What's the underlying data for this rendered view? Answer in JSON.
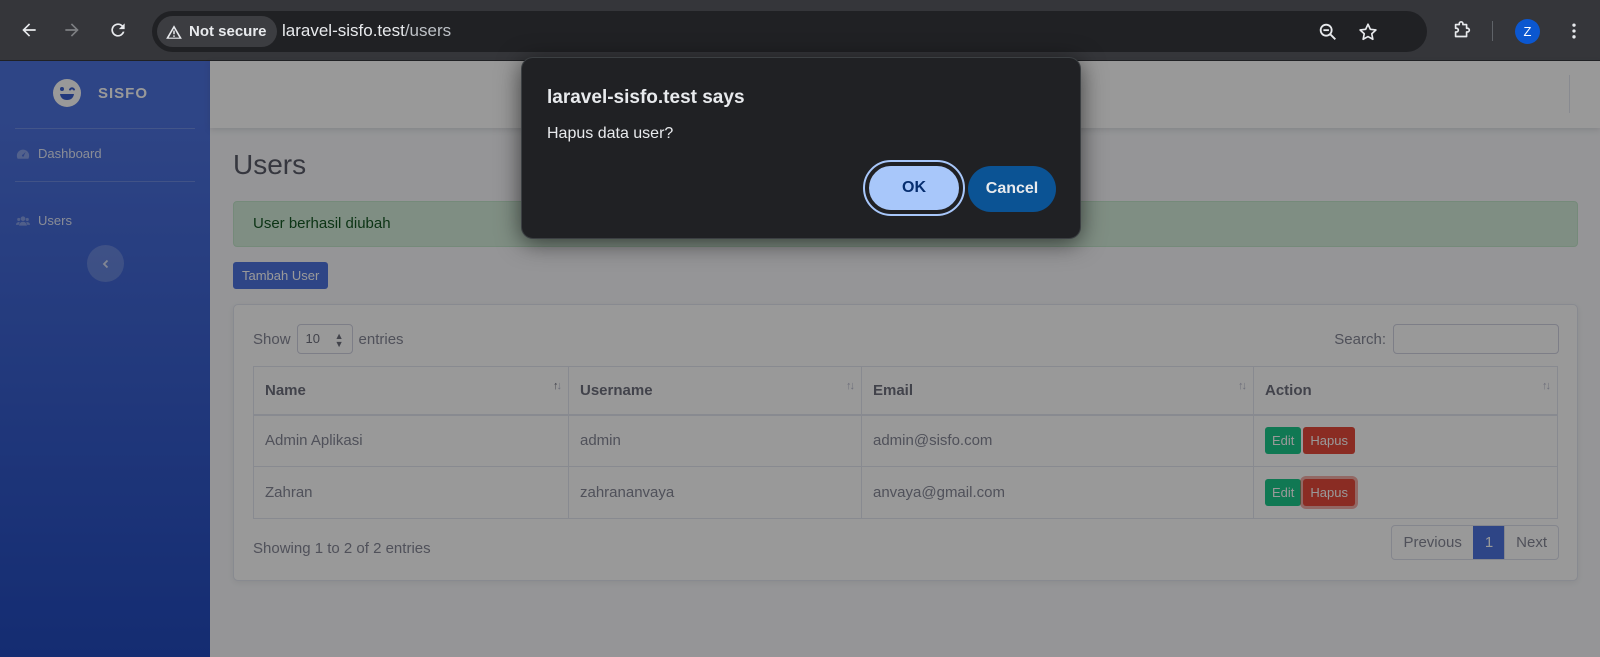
{
  "browser": {
    "security_label": "Not secure",
    "url_host": "laravel-sisfo.test",
    "url_path": "/users",
    "profile_initial": "Z"
  },
  "sidebar": {
    "brand": "SISFO",
    "items": [
      {
        "label": "Dashboard",
        "icon": "tachometer-icon"
      },
      {
        "label": "Users",
        "icon": "users-icon"
      }
    ]
  },
  "main": {
    "title": "Users",
    "alert": "User berhasil diubah",
    "add_button": "Tambah User",
    "table": {
      "show_label": "Show",
      "entries_value": "10",
      "entries_label": "entries",
      "search_label": "Search:",
      "columns": [
        "Name",
        "Username",
        "Email",
        "Action"
      ],
      "rows": [
        {
          "name": "Admin Aplikasi",
          "username": "admin",
          "email": "admin@sisfo.com",
          "edit": "Edit",
          "delete": "Hapus"
        },
        {
          "name": "Zahran",
          "username": "zahrananvaya",
          "email": "anvaya@gmail.com",
          "edit": "Edit",
          "delete": "Hapus"
        }
      ],
      "info": "Showing 1 to 2 of 2 entries",
      "pagination": {
        "previous": "Previous",
        "current": "1",
        "next": "Next"
      }
    }
  },
  "dialog": {
    "title": "laravel-sisfo.test says",
    "message": "Hapus data user?",
    "ok": "OK",
    "cancel": "Cancel"
  },
  "colors": {
    "primary": "#4e73df",
    "success": "#1cc88a",
    "danger": "#e74a3b"
  }
}
